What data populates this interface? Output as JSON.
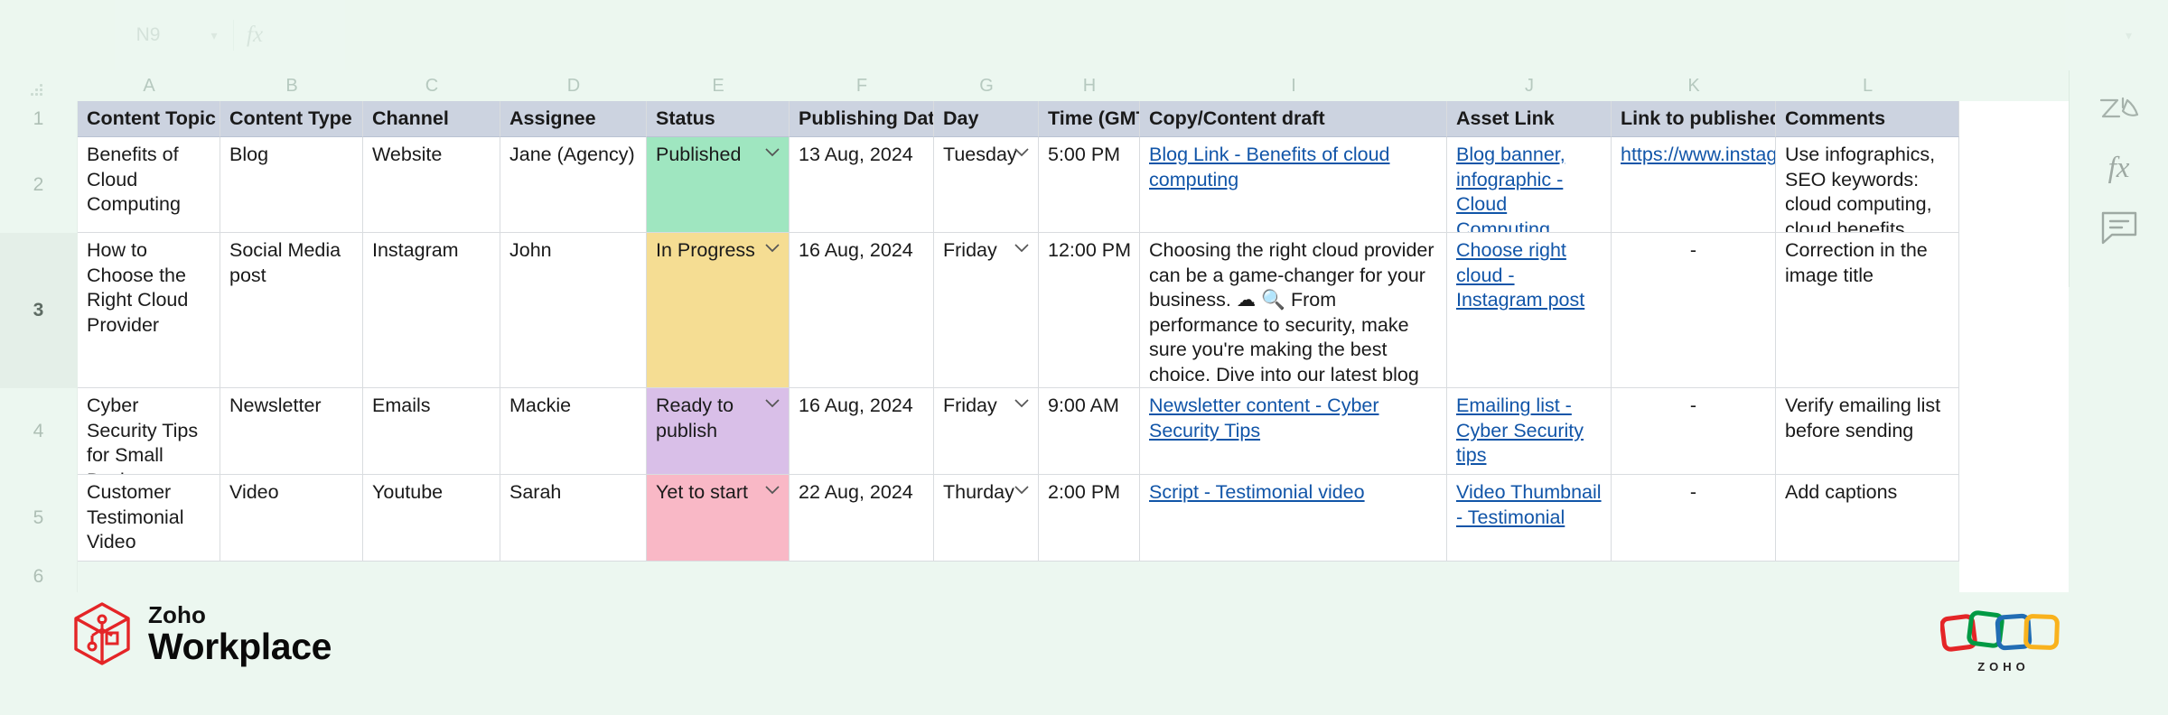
{
  "app": {
    "formula_bar": {
      "cell_ref": "N9",
      "fx_label": "fx",
      "formula_value": ""
    }
  },
  "sheet": {
    "column_letters": [
      "A",
      "B",
      "C",
      "D",
      "E",
      "F",
      "G",
      "H",
      "I",
      "J",
      "K",
      "L"
    ],
    "row_numbers": [
      "1",
      "2",
      "3",
      "4",
      "5",
      "6"
    ],
    "selected_row": "3",
    "headers": [
      "Content Topic",
      "Content Type",
      "Channel",
      "Assignee",
      "Status",
      "Publishing Date",
      "Day",
      "Time (GMT)",
      "Copy/Content draft",
      "Asset Link",
      "Link to published p",
      "Comments"
    ],
    "rows": [
      {
        "row_number": "2",
        "content_topic": "Benefits of Cloud Computing",
        "content_type": "Blog",
        "channel": "Website",
        "assignee": "Jane (Agency)",
        "status": "Published",
        "status_color": "#9fe6c0",
        "publishing_date": "13 Aug, 2024",
        "day": "Tuesday",
        "time": "5:00 PM",
        "copy_draft": "Blog Link - Benefits of cloud computing",
        "copy_is_link": true,
        "asset_link": "Blog banner, infographic - Cloud Computing",
        "published_link": "https://www.instag",
        "published_is_link": true,
        "comments": "Use infographics, SEO keywords: cloud computing, cloud benefits"
      },
      {
        "row_number": "3",
        "content_topic": "How to Choose the Right Cloud Provider",
        "content_type": "Social Media post",
        "channel": "Instagram",
        "assignee": "John",
        "status": "In Progress",
        "status_color": "#f5dd93",
        "publishing_date": "16 Aug, 2024",
        "day": "Friday",
        "time": "12:00 PM",
        "copy_draft": "Choosing the right cloud provider can be a game-changer for your business. ☁ 🔍 From performance to security, make sure you're making the best choice. Dive into our latest blog to learn how!",
        "copy_is_link": false,
        "asset_link": "Choose right cloud - Instagram post",
        "published_link": "-",
        "published_is_link": false,
        "comments": "Correction in the image title"
      },
      {
        "row_number": "4",
        "content_topic": "Cyber Security Tips for Small Businesses",
        "content_type": "Newsletter",
        "channel": "Emails",
        "assignee": "Mackie",
        "status": "Ready to publish",
        "status_color": "#d9bfe8",
        "publishing_date": "16 Aug, 2024",
        "day": "Friday",
        "time": "9:00 AM",
        "copy_draft": "Newsletter content - Cyber Security Tips",
        "copy_is_link": true,
        "asset_link": "Emailing list - Cyber Security tips",
        "published_link": "-",
        "published_is_link": false,
        "comments": "Verify emailing list before sending"
      },
      {
        "row_number": "5",
        "content_topic": "Customer Testimonial Video",
        "content_type": "Video",
        "channel": "Youtube",
        "assignee": "Sarah",
        "status": "Yet to start",
        "status_color": "#f9b8c6",
        "publishing_date": "22 Aug, 2024",
        "day": "Thurday",
        "time": "2:00 PM",
        "copy_draft": "Script - Testimonial video",
        "copy_is_link": true,
        "asset_link": "Video Thumbnail - Testimonial",
        "published_link": "-",
        "published_is_link": false,
        "comments": "Add captions"
      }
    ]
  },
  "right_rail": {
    "items": [
      {
        "name": "zia-icon",
        "label": "Zia"
      },
      {
        "name": "fx-icon",
        "label": "fx"
      },
      {
        "name": "comment-icon",
        "label": ""
      }
    ]
  },
  "footer": {
    "workplace_brand_top": "Zoho",
    "workplace_brand_bottom": "Workplace",
    "zoho_wordmark": "ZOHO",
    "brand_red": "#e42527",
    "zoho_colors": [
      "#e42527",
      "#009a44",
      "#226db4",
      "#f9b21d"
    ]
  }
}
